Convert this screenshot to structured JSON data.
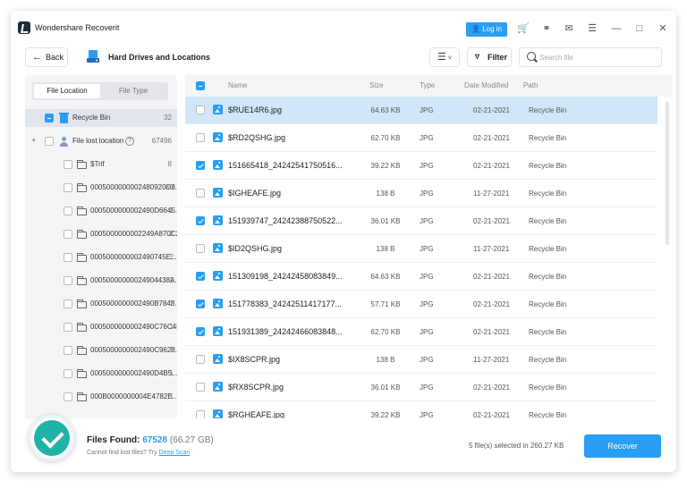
{
  "app": {
    "title": "Wondershare Recoverit"
  },
  "titlebar": {
    "login_label": "Log in",
    "icons": [
      "cart-icon",
      "headset-icon",
      "mail-icon",
      "menu-icon",
      "minimize-icon",
      "maximize-icon",
      "close-icon"
    ]
  },
  "toolbar": {
    "back_label": "Back",
    "location_title": "Hard Drives and Locations",
    "view_icon": "list-view-icon",
    "filter_label": "Filter",
    "search_placeholder": "Search file"
  },
  "sidebar": {
    "tabs": [
      "File Location",
      "File Type"
    ],
    "active_tab": "File Location",
    "recycle_bin": {
      "label": "Recycle Bin",
      "count": "32"
    },
    "lost_location": {
      "label": "File lost location",
      "count": "67496"
    },
    "folders": [
      {
        "label": "$Trif",
        "count": "8"
      },
      {
        "label": "0005000000002480920D3...",
        "count": "68"
      },
      {
        "label": "0005000000002490D6645...",
        "count": "1"
      },
      {
        "label": "0005000000002249A870C2...",
        "count": "2"
      },
      {
        "label": "0005000000002490745E...",
        "count": "2"
      },
      {
        "label": "00050000000024904438A...",
        "count": "1"
      },
      {
        "label": "0005000000002490B7848...",
        "count": "7"
      },
      {
        "label": "0005000000002490C76C4F...",
        "count": "1"
      },
      {
        "label": "0005000000002490C9628...",
        "count": "1"
      },
      {
        "label": "0005000000002490D4B5...",
        "count": "1"
      },
      {
        "label": "000B0000000004E4782E...",
        "count": "1"
      }
    ]
  },
  "table": {
    "columns": [
      "Name",
      "Size",
      "Type",
      "Date Modified",
      "Path"
    ],
    "rows": [
      {
        "name": "$RUE14R6.jpg",
        "size": "64.63 KB",
        "type": "JPG",
        "date": "02-21-2021",
        "path": "Recycle Bin",
        "checked": false,
        "highlight": true
      },
      {
        "name": "$RD2QSHG.jpg",
        "size": "62.70 KB",
        "type": "JPG",
        "date": "02-21-2021",
        "path": "Recycle Bin",
        "checked": false,
        "highlight": false
      },
      {
        "name": "151665418_24242541750516...",
        "size": "39.22 KB",
        "type": "JPG",
        "date": "02-21-2021",
        "path": "Recycle Bin",
        "checked": true,
        "highlight": false
      },
      {
        "name": "$IGHEAFE.jpg",
        "size": "138 B",
        "type": "JPG",
        "date": "11-27-2021",
        "path": "Recycle Bin",
        "checked": false,
        "highlight": false
      },
      {
        "name": "151939747_24242388750522...",
        "size": "36.01 KB",
        "type": "JPG",
        "date": "02-21-2021",
        "path": "Recycle Bin",
        "checked": true,
        "highlight": false
      },
      {
        "name": "$ID2QSHG.jpg",
        "size": "138 B",
        "type": "JPG",
        "date": "11-27-2021",
        "path": "Recycle Bin",
        "checked": false,
        "highlight": false
      },
      {
        "name": "151309198_24242458083849...",
        "size": "64.63 KB",
        "type": "JPG",
        "date": "02-21-2021",
        "path": "Recycle Bin",
        "checked": true,
        "highlight": false
      },
      {
        "name": "151778383_24242511417177...",
        "size": "57.71 KB",
        "type": "JPG",
        "date": "02-21-2021",
        "path": "Recycle Bin",
        "checked": true,
        "highlight": false
      },
      {
        "name": "151931389_24242466083848...",
        "size": "62.70 KB",
        "type": "JPG",
        "date": "02-21-2021",
        "path": "Recycle Bin",
        "checked": true,
        "highlight": false
      },
      {
        "name": "$IX8SCPR.jpg",
        "size": "138 B",
        "type": "JPG",
        "date": "11-27-2021",
        "path": "Recycle Bin",
        "checked": false,
        "highlight": false
      },
      {
        "name": "$RX8SCPR.jpg",
        "size": "36.01 KB",
        "type": "JPG",
        "date": "02-21-2021",
        "path": "Recycle Bin",
        "checked": false,
        "highlight": false
      },
      {
        "name": "$RGHEAFE.jpg",
        "size": "39.22 KB",
        "type": "JPG",
        "date": "02-21-2021",
        "path": "Recycle Bin",
        "checked": false,
        "highlight": false
      }
    ]
  },
  "footer": {
    "files_found_label": "Files Found:",
    "files_found_count": "67528",
    "files_found_size": "(66.27 GB)",
    "hint_text": "Cannot find lost files? Try",
    "hint_link": "Deep Scan",
    "selected_info": "5 file(s) selected in 260.27 KB",
    "recover_label": "Recover"
  },
  "colors": {
    "accent": "#2a9df4",
    "success": "#1fb3a7",
    "row_selected": "#cfe7f8"
  }
}
